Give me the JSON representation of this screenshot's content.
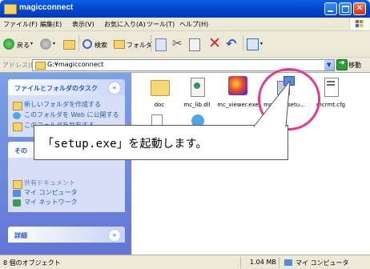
{
  "window": {
    "title": "magicconnect"
  },
  "menubar": {
    "items": [
      "ファイル(F)",
      "編集(E)",
      "表示(V)",
      "お気に入り(A)",
      "ツール(T)",
      "ヘルプ(H)"
    ]
  },
  "toolbar": {
    "back_label": "戻る",
    "search_label": "検索",
    "folders_label": "フォルダ"
  },
  "address": {
    "label": "アドレス(D)",
    "value": "G:¥magicconnect",
    "go_label": "移動"
  },
  "taskpane": {
    "file_tasks": {
      "title": "ファイルとフォルダのタスク",
      "items": [
        "新しいフォルダを作成する",
        "このフォルダを Web に公開する",
        "このフォルダを共有する"
      ]
    },
    "other_places": {
      "title": "その",
      "items": [
        "共有ドキュメント",
        "マイ コンピュータ",
        "マイ ネットワーク"
      ]
    },
    "details": {
      "title": "詳細"
    }
  },
  "files": [
    {
      "name": "doc",
      "type": "folder"
    },
    {
      "name": "mc_lib.dll",
      "type": "dll"
    },
    {
      "name": "mc_viewer.exe",
      "type": "exe"
    },
    {
      "name": "mcclientsetu...",
      "type": "setup"
    },
    {
      "name": "mcrmt.cfg",
      "type": "cfg"
    }
  ],
  "callout": {
    "text": "「setup.exe」を起動します。"
  },
  "statusbar": {
    "left": "8 個のオブジェクト",
    "size": "1.04 MB",
    "location": "マイ コンピュータ"
  },
  "colors": {
    "title_blue": "#0348D0",
    "highlight_ring": "#E8388C",
    "task_link": "#215DC6"
  }
}
